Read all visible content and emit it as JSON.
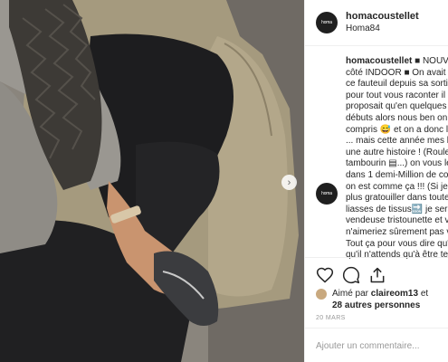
{
  "post": {
    "username": "homacoustellet",
    "location": "Homa84",
    "avatar_text": "homa"
  },
  "caption_lines": [
    "côté INDOOR ■ On avait c",
    "ce fauteuil depuis sa sortie",
    "pour tout vous raconter il n",
    "proposait qu'en quelques c",
    "débuts alors nous ben on a",
    "compris 😅 et on a donc la",
    "... mais cette année mes lo",
    "une autre histoire ! (Rouler",
    "tambourin ▤...) on vous le",
    "dans 1 demi-Million de col",
    "on est comme ça !!! (Si je n",
    "plus gratouiller dans toute",
    "liasses de tissus🔜 je sera",
    "vendeuse tristounette et v",
    "n'aimeriez sûrement pas v",
    "Tout ça pour vous dire qu'",
    "qu'il n'attends qu'à être te"
  ],
  "caption_first_rest": " ■ NOUVE",
  "likes": {
    "prefix": "Aimé par ",
    "first_user": "claireom13",
    "conjunction": " et",
    "others": "28 autres personnes"
  },
  "date": "20 MARS",
  "comment_placeholder": "Ajouter un commentaire...",
  "icons": [
    "heart-icon",
    "comment-icon",
    "share-icon",
    "chevron-right-icon"
  ]
}
